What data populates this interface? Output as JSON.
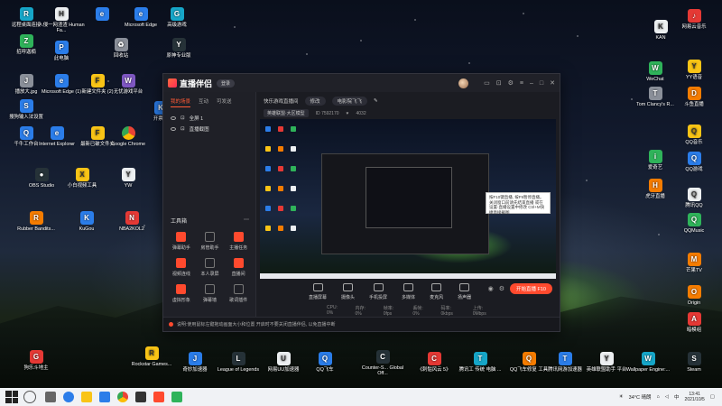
{
  "desktop": {
    "icons": [
      {
        "label": "远程桌面连接",
        "glyph": "R",
        "color": "teal"
      },
      {
        "label": "入侵一网渣渣 Human Fa...",
        "glyph": "H",
        "color": "white"
      },
      {
        "label": "",
        "glyph": "e",
        "color": "blue"
      },
      {
        "label": "Microsoft Edge",
        "glyph": "e",
        "color": "blue"
      },
      {
        "label": "高级游戏",
        "glyph": "G",
        "color": "teal"
      },
      {
        "label": "招呼迦楠",
        "glyph": "Z",
        "color": "green"
      },
      {
        "label": "此电脑",
        "glyph": "P",
        "color": "blue"
      },
      {
        "label": "回收站",
        "glyph": "♻",
        "color": "gray"
      },
      {
        "label": "原神专业版",
        "glyph": "Y",
        "color": "dark"
      },
      {
        "label": "播放大.jpg",
        "glyph": "J",
        "color": "gray"
      },
      {
        "label": "Microsoft Edge (1)",
        "glyph": "e",
        "color": "blue"
      },
      {
        "label": "新建文件夹 (2)",
        "glyph": "F",
        "color": "yellow"
      },
      {
        "label": "无忧游戏平台",
        "glyph": "W",
        "color": "purple"
      },
      {
        "label": "搜狗输入法设置",
        "glyph": "S",
        "color": "blue"
      },
      {
        "label": "开票机",
        "glyph": "K",
        "color": "blue"
      },
      {
        "label": "千牛工作台",
        "glyph": "Q",
        "color": "blue"
      },
      {
        "label": "Internet Explorer",
        "glyph": "e",
        "color": "blue"
      },
      {
        "label": "最新已破文件夹",
        "glyph": "F",
        "color": "yellow"
      },
      {
        "label": "Google Chrome",
        "glyph": "",
        "color": "chrome"
      },
      {
        "label": "OBS Studio",
        "glyph": "●",
        "color": "dark"
      },
      {
        "label": "小白视频工具",
        "glyph": "X",
        "color": "yellow"
      },
      {
        "label": "YW",
        "glyph": "Y",
        "color": "white"
      },
      {
        "label": "Rubber Bandits...",
        "glyph": "R",
        "color": "orange"
      },
      {
        "label": "KuGou",
        "glyph": "K",
        "color": "blue"
      },
      {
        "label": "NBA2KOL2",
        "glyph": "N",
        "color": "red"
      },
      {
        "label": "KAN",
        "glyph": "K",
        "color": "white"
      },
      {
        "label": "网易云音乐",
        "glyph": "♪",
        "color": "red"
      },
      {
        "label": "YY语音",
        "glyph": "Y",
        "color": "yellow"
      },
      {
        "label": "WeChat",
        "glyph": "W",
        "color": "green"
      },
      {
        "label": "斗鱼直播",
        "glyph": "D",
        "color": "orange"
      },
      {
        "label": "Tom Clancy's R...",
        "glyph": "T",
        "color": "gray"
      },
      {
        "label": "QQ音乐",
        "glyph": "Q",
        "color": "yellow"
      },
      {
        "label": "爱奇艺",
        "glyph": "i",
        "color": "green"
      },
      {
        "label": "QQ游戏",
        "glyph": "Q",
        "color": "blue"
      },
      {
        "label": "虎牙直播",
        "glyph": "H",
        "color": "orange"
      },
      {
        "label": "腾讯QQ",
        "glyph": "Q",
        "color": "white"
      },
      {
        "label": "QQMusic",
        "glyph": "Q",
        "color": "green"
      },
      {
        "label": "芒果TV",
        "glyph": "M",
        "color": "orange"
      },
      {
        "label": "Origin",
        "glyph": "O",
        "color": "orange"
      },
      {
        "label": "暗模组",
        "glyph": "A",
        "color": "red"
      },
      {
        "label": "Steam",
        "glyph": "S",
        "color": "dark"
      },
      {
        "label": "狗乐斗地主",
        "glyph": "G",
        "color": "red"
      },
      {
        "label": "Rockstar Games...",
        "glyph": "R",
        "color": "yellow"
      },
      {
        "label": "奇妙加速器",
        "glyph": "J",
        "color": "blue"
      },
      {
        "label": "League of Legends",
        "glyph": "L",
        "color": "dark"
      },
      {
        "label": "网易UU加速器",
        "glyph": "U",
        "color": "white"
      },
      {
        "label": "QQ飞车",
        "glyph": "Q",
        "color": "blue"
      },
      {
        "label": "Counter-S... Global Off...",
        "glyph": "C",
        "color": "dark"
      },
      {
        "label": "《刺骷风云 5》",
        "glyph": "C",
        "color": "red"
      },
      {
        "label": "腾讯工 传统 电脑 ...",
        "glyph": "T",
        "color": "teal"
      },
      {
        "label": "QQ飞车修复 工具",
        "glyph": "Q",
        "color": "orange"
      },
      {
        "label": "腾讯网游加速器",
        "glyph": "T",
        "color": "blue"
      },
      {
        "label": "英雄联盟助手 平台",
        "glyph": "Y",
        "color": "white"
      },
      {
        "label": "Wallpaper Engine:...",
        "glyph": "W",
        "color": "teal"
      }
    ]
  },
  "app": {
    "title": "直播伴侣",
    "version_badge": "登录",
    "title_icons": [
      "screen-icon",
      "gift-icon",
      "settings-icon",
      "menu-icon",
      "minimize-icon",
      "maximize-icon",
      "close-icon"
    ],
    "side_tabs": [
      "我的场景",
      "互动",
      "可发送"
    ],
    "scenes": [
      {
        "label": "全屏 1"
      },
      {
        "label": "直播截图"
      }
    ],
    "toolbox_title": "工具箱",
    "tools": [
      {
        "label": "弹幕助手",
        "hot": true
      },
      {
        "label": "房管助手",
        "hot": false
      },
      {
        "label": "主播任务",
        "hot": true
      },
      {
        "label": "视频连线",
        "hot": true
      },
      {
        "label": "本人录屏",
        "hot": false
      },
      {
        "label": "直播间",
        "hot": true
      },
      {
        "label": "虚拟形象",
        "hot": true
      },
      {
        "label": "弹幕墙",
        "hot": false
      },
      {
        "label": "歌词插件",
        "hot": false
      }
    ],
    "stream_title": "快乐游戏直播间",
    "stream_pill_1": "修改",
    "stream_pill_2": "电影院飞飞",
    "category": "英雄联盟·大区模型",
    "room_id_label": "ID",
    "room_id": "7592170",
    "fans_label": "4032",
    "controls": [
      {
        "label": "直播屏幕"
      },
      {
        "label": "摄像头"
      },
      {
        "label": "手机投屏"
      },
      {
        "label": "多媒体"
      },
      {
        "label": "麦克风"
      },
      {
        "label": "扬声器"
      }
    ],
    "go_live": "开始直播 F10",
    "stats": [
      "CPU: 0%",
      "内存: 0%",
      "帧率: 0fps",
      "丢帧: 0%",
      "码率: 0kbps",
      "上传: 0Mbps"
    ],
    "status_text": "说明:使用鼠标左键拖动画面大小和位置 开启时不要关闭直播伴侣, 以免直播中断"
  },
  "tooltip": {
    "text": "按F10键直播, 按F9暂停直播。关闭窗口前请先结束直播 或在设置-直播设置中修改 Ctrl+M快捷直接截图"
  },
  "taskbar": {
    "weather": "34°C 晴朗",
    "time": "13:41",
    "date": "2021/10/5",
    "lang": "中"
  }
}
